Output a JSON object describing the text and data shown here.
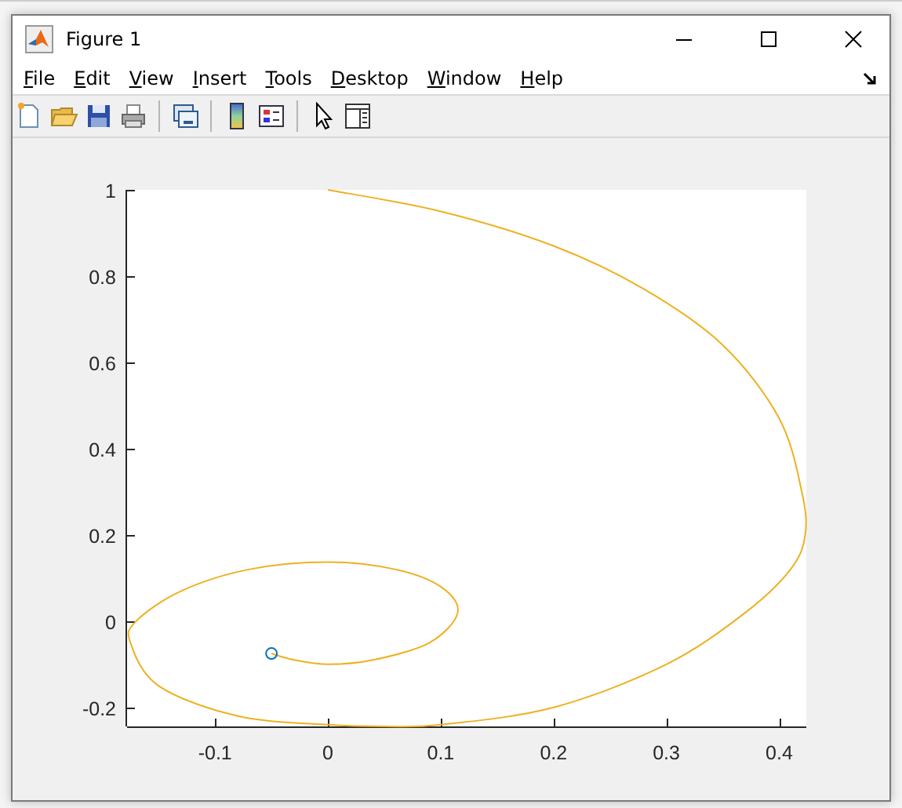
{
  "window": {
    "title": "Figure 1"
  },
  "menu": [
    {
      "label": "File"
    },
    {
      "label": "Edit"
    },
    {
      "label": "View"
    },
    {
      "label": "Insert"
    },
    {
      "label": "Tools"
    },
    {
      "label": "Desktop"
    },
    {
      "label": "Window"
    },
    {
      "label": "Help"
    }
  ],
  "toolbar": [
    {
      "kind": "new"
    },
    {
      "kind": "open"
    },
    {
      "kind": "save"
    },
    {
      "kind": "print"
    },
    {
      "kind": "sep"
    },
    {
      "kind": "link"
    },
    {
      "kind": "sep"
    },
    {
      "kind": "colorbar"
    },
    {
      "kind": "legend"
    },
    {
      "kind": "sep"
    },
    {
      "kind": "pointer"
    },
    {
      "kind": "panel"
    }
  ],
  "plot": {
    "chart_data": {
      "type": "line",
      "x": [
        0,
        0.1,
        0.2,
        0.28,
        0.35,
        0.4,
        0.42,
        0.423,
        0.41,
        0.37,
        0.3,
        0.2,
        0.1,
        0.05,
        0,
        -0.08,
        -0.15,
        -0.175,
        -0.17,
        -0.13,
        -0.07,
        0,
        0.06,
        0.1,
        0.115,
        0.09,
        0.04,
        0,
        -0.03,
        -0.05
      ],
      "xlim": [
        -0.178,
        0.424
      ],
      "ylim": [
        -0.244,
        1
      ],
      "xticks": [
        {
          "value": -0.1,
          "label": "-0.1"
        },
        {
          "value": 0,
          "label": "0"
        },
        {
          "value": 0.1,
          "label": "0.1"
        },
        {
          "value": 0.2,
          "label": "0.2"
        },
        {
          "value": 0.3,
          "label": "0.3"
        },
        {
          "value": 0.4,
          "label": "0.4"
        }
      ],
      "yticks": [
        {
          "value": -0.2,
          "label": "-0.2"
        },
        {
          "value": 0,
          "label": "0"
        },
        {
          "value": 0.2,
          "label": "0.2"
        },
        {
          "value": 0.4,
          "label": "0.4"
        },
        {
          "value": 0.6,
          "label": "0.6"
        },
        {
          "value": 0.8,
          "label": "0.8"
        },
        {
          "value": 1,
          "label": "1"
        }
      ],
      "series": [
        {
          "color": "#edb120",
          "marker": "none",
          "values": [
            1,
            0.95,
            0.87,
            0.77,
            0.64,
            0.47,
            0.3,
            0.2,
            0.12,
            0.02,
            -0.1,
            -0.2,
            -0.24,
            -0.244,
            -0.24,
            -0.22,
            -0.15,
            -0.05,
            0,
            0.07,
            0.12,
            0.137,
            0.12,
            0.08,
            0.02,
            -0.05,
            -0.09,
            -0.1,
            -0.09,
            -0.075
          ]
        },
        {
          "color": "#0072bd",
          "marker": "o",
          "values": [
            null,
            null,
            null,
            null,
            null,
            null,
            null,
            null,
            null,
            null,
            null,
            null,
            null,
            null,
            null,
            null,
            null,
            null,
            null,
            null,
            null,
            null,
            null,
            null,
            null,
            null,
            null,
            null,
            null,
            -0.075
          ]
        }
      ]
    }
  }
}
